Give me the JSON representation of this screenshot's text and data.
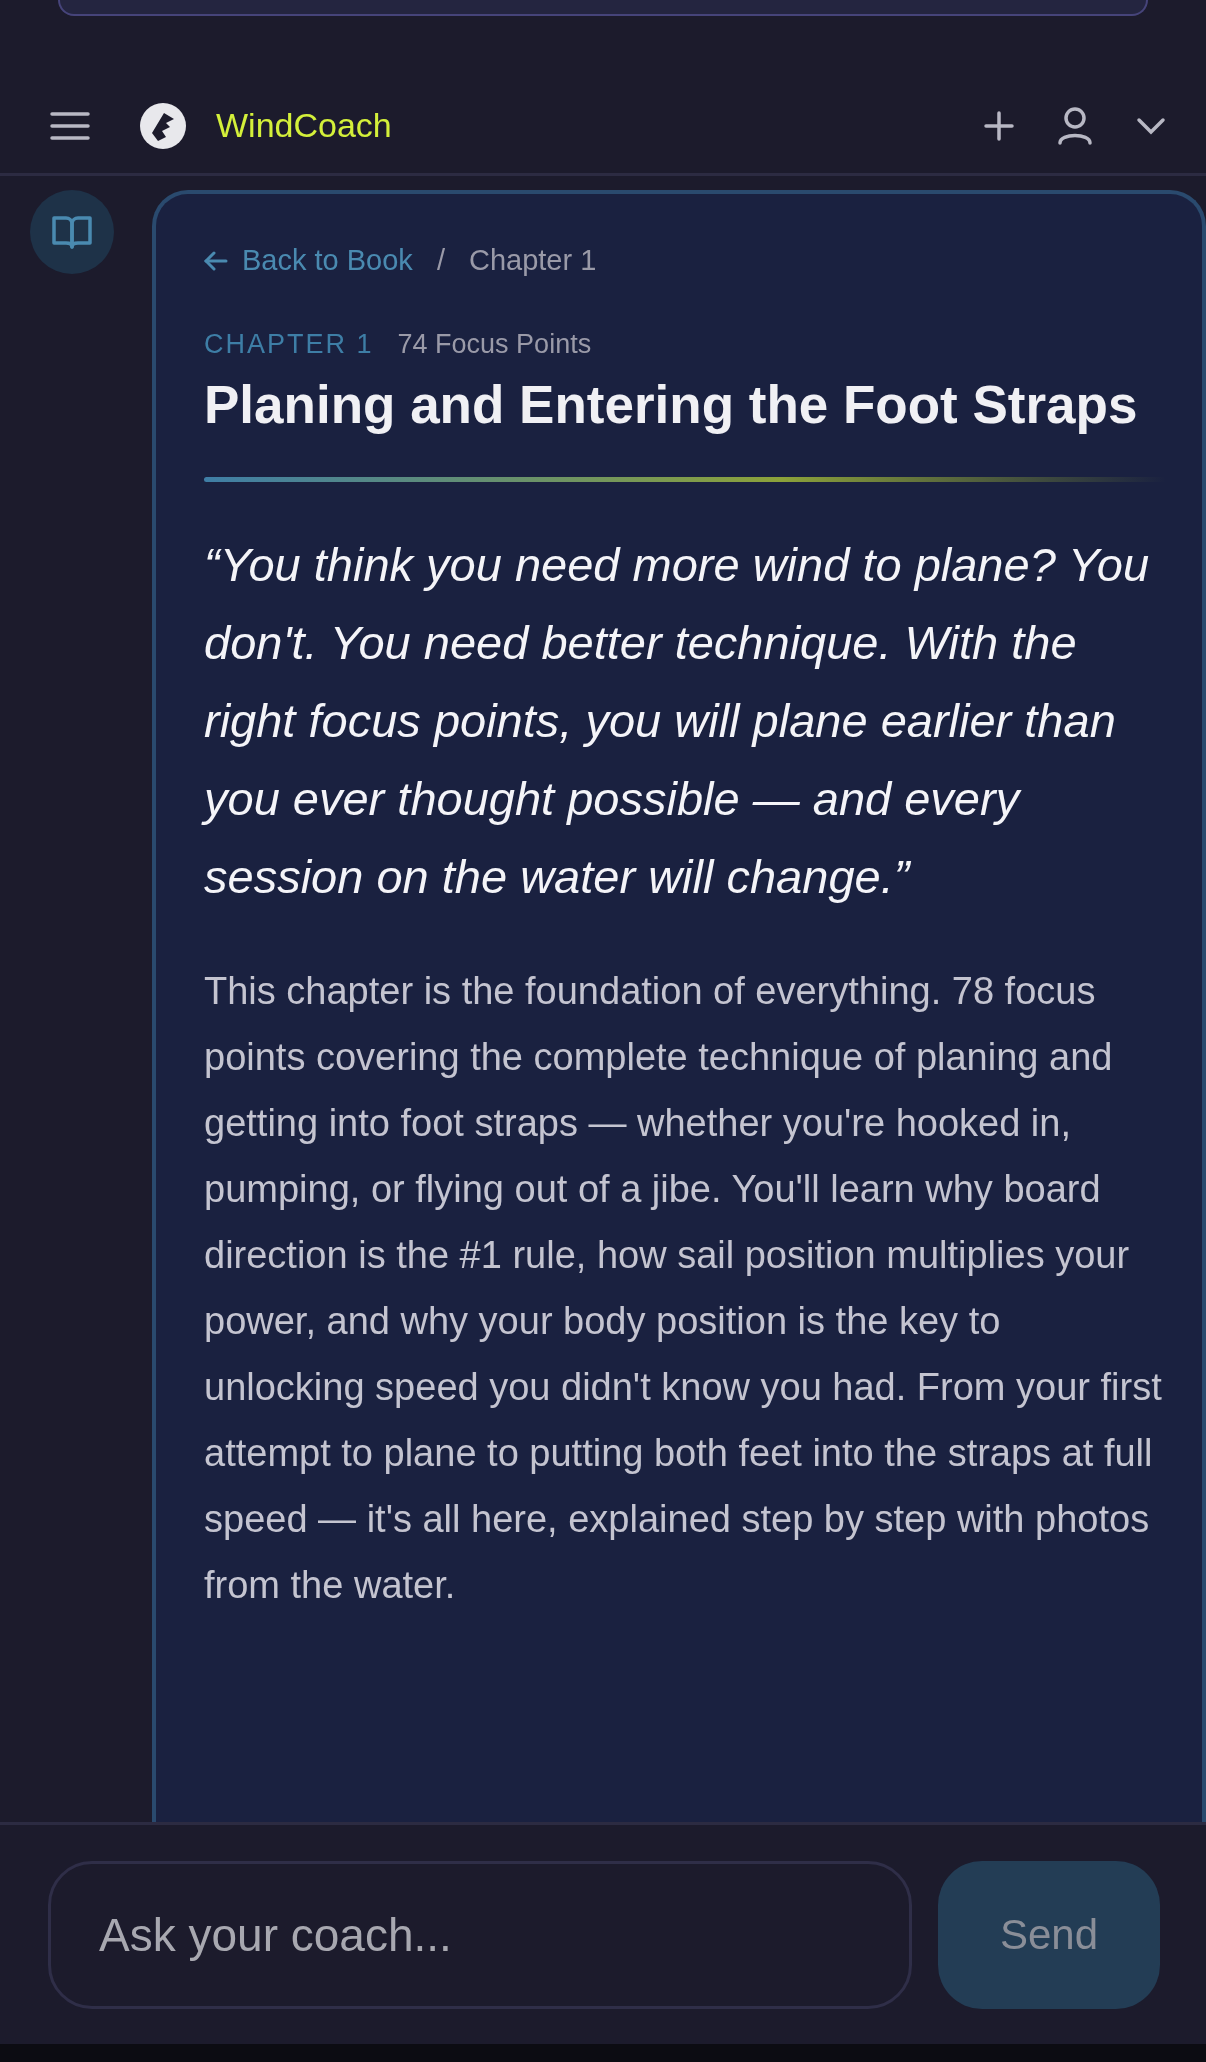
{
  "app": {
    "name": "WindCoach"
  },
  "breadcrumb": {
    "back": "Back to Book",
    "separator": "/",
    "current": "Chapter 1"
  },
  "chapter": {
    "label": "CHAPTER 1",
    "focus_points": "74 Focus Points",
    "title": "Planing and Entering the Foot Straps"
  },
  "quote": "“You think you need more wind to plane? You don't. You need better technique. With the right focus points, you will plane earlier than you ever thought possible — and every session on the water will change.”",
  "description": "This chapter is the foundation of everything. 78 focus points covering the complete technique of planing and getting into foot straps — whether you're hooked in, pumping, or flying out of a jibe. You'll learn why board direction is the #1 rule, how sail position multiplies your power, and why your body position is the key to unlocking speed you didn't know you had. From your first attempt to plane to putting both feet into the straps at full speed — it's all here, explained step by step with photos from the water.",
  "chat": {
    "placeholder": "Ask your coach...",
    "send": "Send"
  }
}
